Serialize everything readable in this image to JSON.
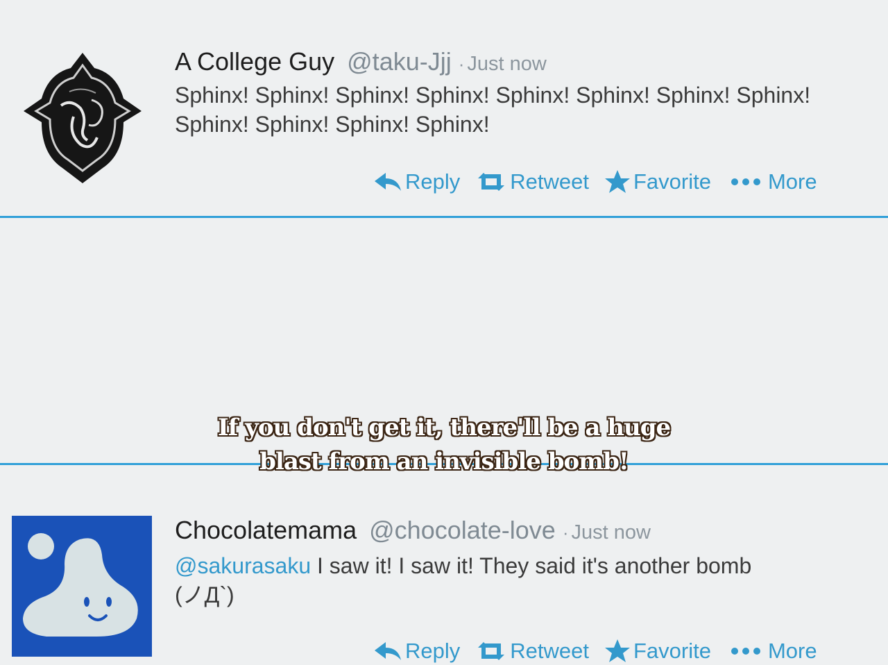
{
  "tweets": [
    {
      "name": "A College Guy",
      "handle": "@taku-Jjj",
      "separator": "·",
      "time": "Just now",
      "text_line1": "Sphinx! Sphinx! Sphinx! Sphinx! Sphinx! Sphinx! Sphinx! Sphinx!",
      "text_line2": "Sphinx! Sphinx! Sphinx! Sphinx!",
      "avatar_icon": "ornate-crest-icon",
      "actions": {
        "reply": "Reply",
        "retweet": "Retweet",
        "favorite": "Favorite",
        "more": "More"
      }
    },
    {
      "name": "Chocolatemama",
      "handle": "@chocolate-love",
      "separator": "·",
      "time": "Just now",
      "mention": "@sakurasaku",
      "text_rest": " I saw it! I saw it! They said it's another bomb",
      "text_line2": "(ノД`)",
      "avatar_icon": "blob-smiley-icon",
      "actions": {
        "reply": "Reply",
        "retweet": "Retweet",
        "favorite": "Favorite",
        "more": "More"
      }
    }
  ],
  "subtitle": {
    "line1": "If you don't get it, there'll be a huge",
    "line2": "blast from an invisible bomb!"
  },
  "colors": {
    "accent": "#3399cc",
    "divider": "#2f9fd8",
    "background": "#eef0f1",
    "avatar2_bg": "#1a52b8"
  }
}
